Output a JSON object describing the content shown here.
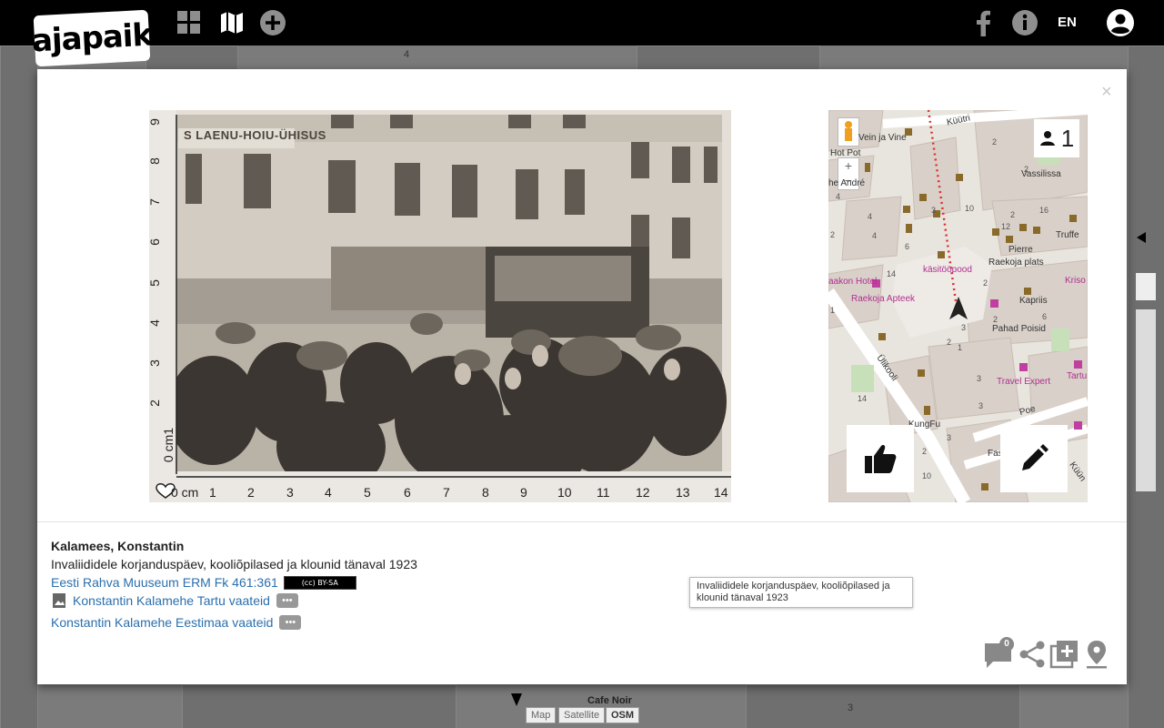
{
  "app": {
    "logo_text": "ajapaik"
  },
  "topbar": {
    "icons": [
      "grid-icon",
      "map-icon",
      "add-circle-icon",
      "facebook-icon",
      "info-icon",
      "user-account-icon"
    ],
    "lang": "EN"
  },
  "modal": {
    "close": "×",
    "photo": {
      "ruler_vertical": [
        "9",
        "8",
        "7",
        "6",
        "5",
        "4",
        "3",
        "2",
        "0 cm1"
      ],
      "ruler_horizontal": [
        "0 cm",
        "1",
        "2",
        "3",
        "4",
        "5",
        "6",
        "7",
        "8",
        "9",
        "10",
        "11",
        "12",
        "13",
        "14"
      ],
      "sign_text": "S LAENU-HOIU-ÜHISUS"
    },
    "map": {
      "rephoto_count": "1",
      "labels": {
        "kuutri": "Küütri",
        "vein_ja_vine": "Vein ja Vine",
        "hot_pot": "Hot Pot",
        "andre": "he André",
        "vassilissa": "Vassilissa",
        "truffe": "Truffe",
        "pierre": "Pierre",
        "raekoja_plats": "Raekoja plats",
        "kasitoopood": "käsitööpood",
        "kriso": "Kriso",
        "aakon_hotel": "aakon Hotel",
        "raekoja_apteek": "Raekoja Apteek",
        "kapriis": "Kapriis",
        "pahad_poisid": "Pahad Poisid",
        "ulikooli": "Ülikooli",
        "travel_expert": "Travel Expert",
        "tartu_ulikool": "Tartu Üli Keskin Apte",
        "poe": "Poe",
        "kungfu": "KungFu",
        "fas_ba": "Fas Ba",
        "kuuni": "Küün"
      },
      "house_numbers": [
        "2",
        "2",
        "2",
        "16",
        "4",
        "3",
        "10",
        "4",
        "12",
        "2",
        "4",
        "6",
        "14",
        "2",
        "1",
        "2",
        "3",
        "1",
        "3",
        "6",
        "14",
        "3",
        "10",
        "3",
        "2",
        "2",
        "3"
      ]
    },
    "info": {
      "author": "Kalamees, Konstantin",
      "description": "Invaliididele korjanduspäev, kooliõpilased ja klounid tänaval 1923",
      "source_link": "Eesti Rahva Muuseum ERM Fk 461:361",
      "license_badge": "BY-SA",
      "album_links": [
        "Konstantin Kalamehe Tartu vaateid",
        "Konstantin Kalamehe Eestimaa vaateid"
      ]
    },
    "tooltip": "Invaliididele korjanduspäev, kooliõpilased ja klounid tänaval 1923",
    "comment_count": "0",
    "bottom_icons": [
      "comment-icon",
      "share-icon",
      "add-to-album-icon",
      "location-pin-icon"
    ]
  },
  "background_map": {
    "labels": {
      "cafe_noir": "Cafe Noir",
      "num3": "3",
      "num4": "4"
    },
    "map_types": [
      "Map",
      "Satellite",
      "OSM"
    ]
  }
}
